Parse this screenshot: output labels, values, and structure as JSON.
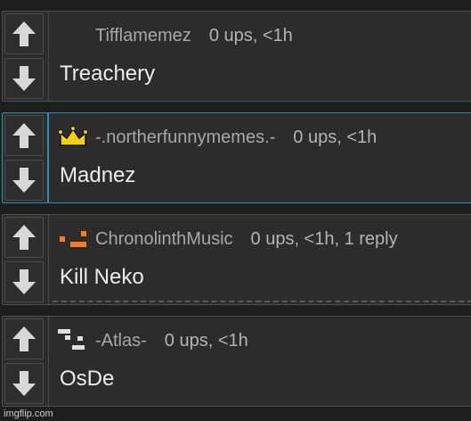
{
  "comments": [
    {
      "username": "Tifflamemez",
      "info": "0 ups, <1h",
      "text": "Treachery",
      "badge": "none"
    },
    {
      "username": "-.northerfunnymemes.-",
      "info": "0 ups, <1h",
      "text": "Madnez",
      "badge": "crown-icon"
    },
    {
      "username": "ChronolinthMusic",
      "info": "0 ups, <1h, 1 reply",
      "text": "Kill Neko",
      "badge": "orange-pixel-icon"
    },
    {
      "username": "-Atlas-",
      "info": "0 ups, <1h",
      "text": "OsDe",
      "badge": "white-pixel-icon"
    }
  ],
  "watermark": "imgflip.com",
  "colors": {
    "background": "#1e1e1e",
    "panel": "#2c2c2c",
    "active_border": "#2a8fb5",
    "crown": "#f0d20a",
    "orange_badge": "#ff7a1a"
  },
  "icons": {
    "upvote": "arrow-up-icon",
    "downvote": "arrow-down-icon"
  }
}
